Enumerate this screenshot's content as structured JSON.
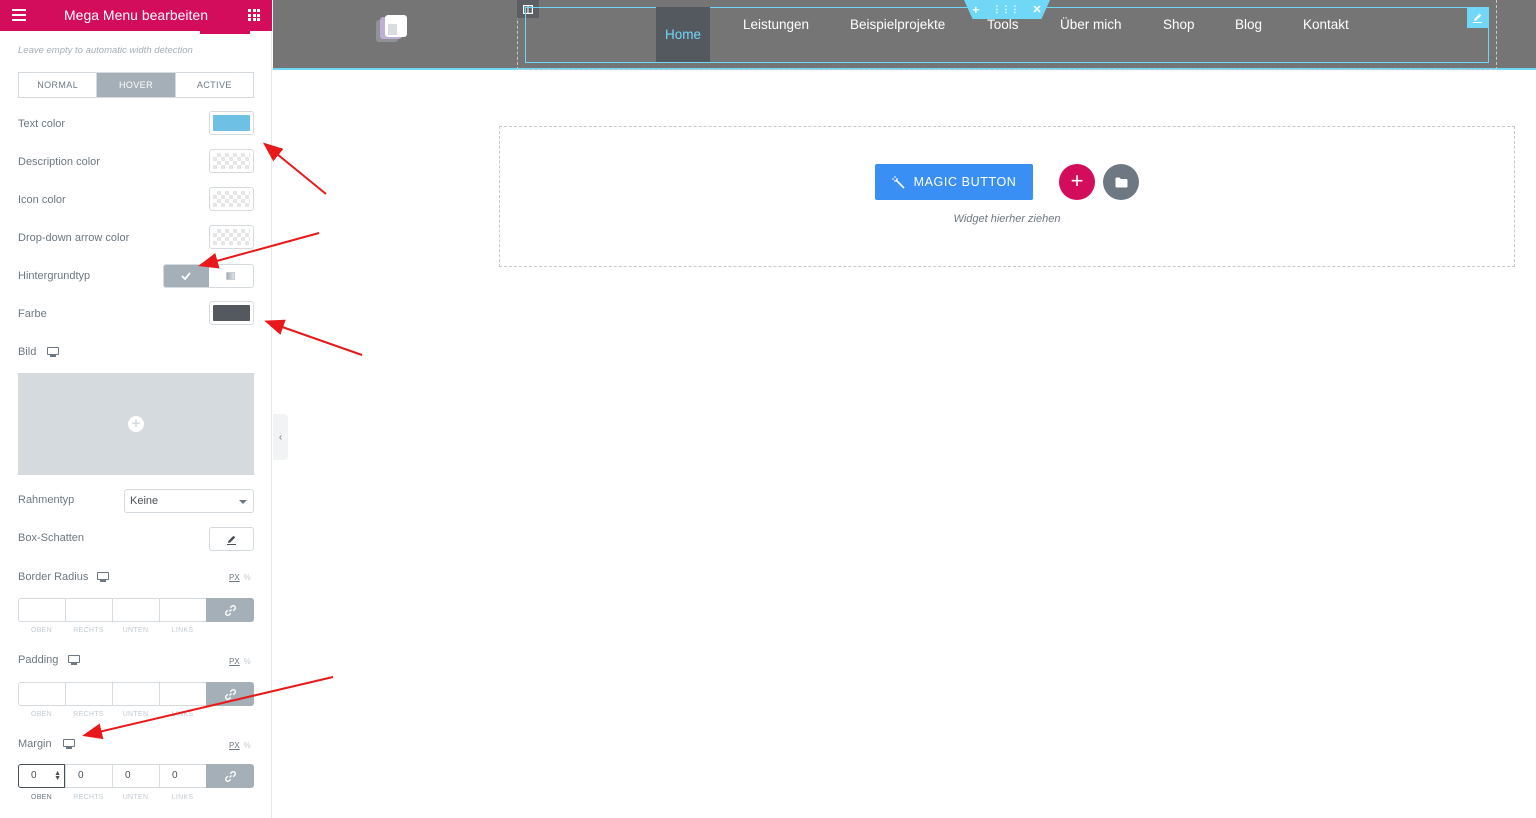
{
  "panel": {
    "title": "Mega Menu bearbeiten",
    "width_hint": "Leave empty to automatic width detection",
    "state_tabs": [
      "NORMAL",
      "HOVER",
      "ACTIVE"
    ],
    "active_state": "HOVER",
    "controls": {
      "text_color_label": "Text color",
      "text_color": "#6ec1e4",
      "description_color_label": "Description color",
      "icon_color_label": "Icon color",
      "dropdown_arrow_color_label": "Drop-down arrow color",
      "background_type_label": "Hintergrundtyp",
      "color_label": "Farbe",
      "color_value": "#54595f",
      "image_label": "Bild",
      "border_type_label": "Rahmentyp",
      "border_type_value": "Keine",
      "box_shadow_label": "Box-Schatten",
      "border_radius_label": "Border Radius",
      "padding_label": "Padding",
      "margin_label": "Margin",
      "unit_px": "PX",
      "unit_percent": "%",
      "side_labels": [
        "OBEN",
        "RECHTS",
        "UNTEN",
        "LINKS"
      ],
      "margin_values": [
        "0",
        "0",
        "0",
        "0"
      ]
    }
  },
  "preview": {
    "nav": {
      "items": [
        "Home",
        "Leistungen",
        "Beispielprojekte",
        "Tools",
        "Über mich",
        "Shop",
        "Blog",
        "Kontakt"
      ],
      "active": "Home"
    },
    "tools_tab": {
      "add": "+",
      "move": "⋮⋮⋮",
      "close": "✕"
    },
    "magic_button": "MAGIC BUTTON",
    "drop_hint": "Widget hierher ziehen"
  },
  "colors": {
    "brand": "#d30c5c",
    "accent": "#71d7f7",
    "magic_button": "#3a8ff5",
    "header_bg": "#757575",
    "annotation_arrow": "#e8191b"
  },
  "icons": [
    "hamburger-icon",
    "apps-grid-icon",
    "checkmark-icon",
    "gradient-icon",
    "monitor-icon",
    "add-image-icon",
    "pencil-icon",
    "link-icon",
    "chevron-left-icon",
    "columns-icon",
    "magic-wand-icon",
    "plus-icon",
    "folder-icon"
  ]
}
